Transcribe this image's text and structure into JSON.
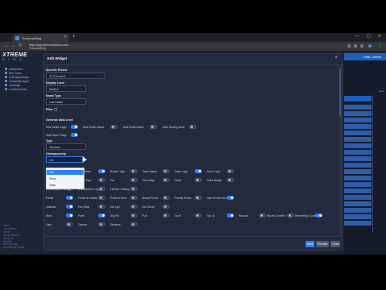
{
  "browser": {
    "tab_title": "Themesetting",
    "url_line1": "https://app.xtremesimulator.com/...",
    "url_line2": "Themesetting",
    "window_controls": [
      "—",
      "▢",
      "✕"
    ]
  },
  "app": {
    "logo_main": "XTREME",
    "logo_sub": "S I M S",
    "nav": [
      "Dashboard",
      "Sim Trees",
      "Championships",
      "Corporate Apps",
      "Overlays",
      "Leaderboards"
    ],
    "footer_links": [
      "Team",
      "Competition",
      "Admin",
      "Setup Wizards",
      "Sessions",
      "Results",
      "Show config",
      "Sim Racing Config"
    ],
    "right_panel_header": "Hello, Xtreme",
    "right_panel_col": "Rank"
  },
  "modal": {
    "title": "Edit Widget",
    "close": "×",
    "fields": {
      "specific_events_label": "Specific Events",
      "specific_events_value": "GT3 Round 6",
      "display_level_label": "Display Level",
      "display_level_value": "Medium",
      "name_type_label": "Name Type",
      "name_type_value": "Last Initials",
      "filter_label": "Filter",
      "override_data_label": "Override Data Level",
      "template_label": "Type",
      "template_value": "Standard",
      "championship_label": "Championship",
      "championship_value": "Cat"
    },
    "row_toggles_1": [
      {
        "label": "Hide Series Logo",
        "on": true
      },
      {
        "label": "Hide Series Name",
        "on": false
      },
      {
        "label": "Hide Series Desc",
        "on": false
      },
      {
        "label": "Hide Scoring Links",
        "on": false
      }
    ],
    "hide_driver_flags_label": "Hide Driver Flags",
    "dropdown_options": [
      "Cat",
      "Driver",
      "Team"
    ],
    "grid": [
      [
        {
          "label": "Lap #",
          "on": true
        },
        {
          "label": "Split Times",
          "on": true
        },
        {
          "label": "Rookie Type",
          "on": false
        },
        {
          "label": "Team Name",
          "on": false
        },
        {
          "label": "Team Logo",
          "on": true
        },
        {
          "label": "Driver Type",
          "on": false
        }
      ],
      [
        {
          "label": "Driver",
          "on": true
        },
        {
          "label": "Driver Type",
          "on": false
        },
        {
          "label": "Car",
          "on": false
        },
        {
          "label": "Car Image",
          "on": false
        },
        {
          "label": "Class",
          "on": false
        },
        {
          "label": "Class Badge",
          "on": false
        }
      ],
      [
        {
          "label": "Manufacturer Name",
          "on": false
        },
        {
          "label": "Manufacturer Logo",
          "on": false
        },
        {
          "label": "Licence / Rating",
          "on": false
        }
      ],
      [
        {
          "label": "Points",
          "on": true
        },
        {
          "label": "Points to Leader",
          "on": false
        },
        {
          "label": "Points to Next",
          "on": false
        },
        {
          "label": "Bonus Points",
          "on": false
        },
        {
          "label": "Penalty Points",
          "on": false
        },
        {
          "label": "Hide If Point Drivers",
          "on": true
        }
      ],
      [
        {
          "label": "Indicator",
          "on": true
        },
        {
          "label": "Pos Rank",
          "on": false
        },
        {
          "label": "Incl Lap",
          "on": false
        },
        {
          "label": "Inc Corner",
          "on": false
        }
      ],
      [
        {
          "label": "Wins",
          "on": true
        },
        {
          "label": "Poles",
          "on": true
        },
        {
          "label": "Avg Fin",
          "on": false
        },
        {
          "label": "Pod",
          "on": false
        },
        {
          "label": "Top 5",
          "on": false
        },
        {
          "label": "Top 10",
          "on": true
        },
        {
          "label": "Rounds",
          "on": false
        },
        {
          "label": "Races Counted",
          "on": false
        },
        {
          "label": "Remaining Counted",
          "on": true
        }
      ],
      [
        {
          "label": "Laps",
          "on": false
        },
        {
          "label": "Carrera",
          "on": false
        },
        {
          "label": "Distance",
          "on": false
        }
      ]
    ],
    "buttons": {
      "save": "Save",
      "preview": "Preview",
      "close": "Close"
    }
  }
}
